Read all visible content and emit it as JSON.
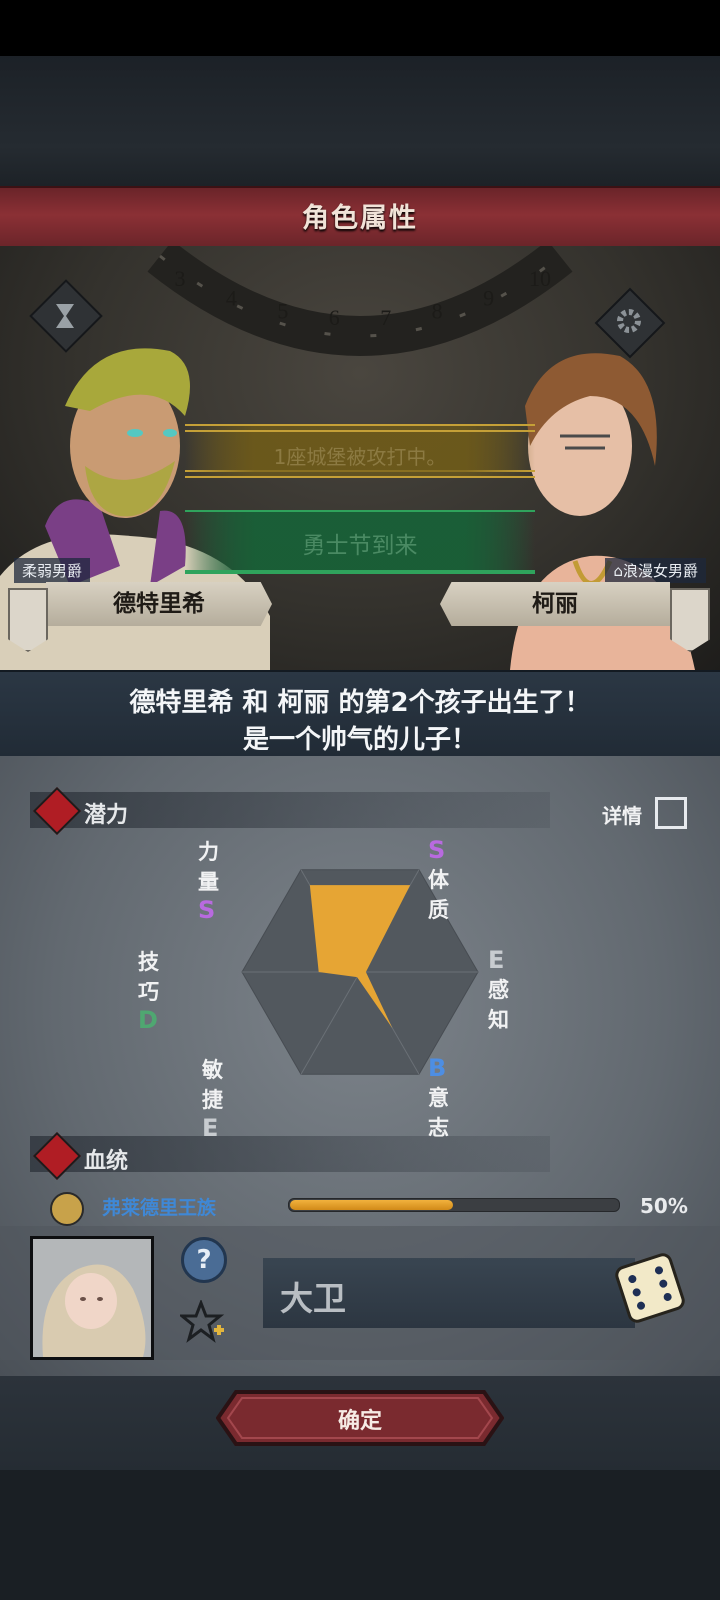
{
  "header": {
    "title": "角色属性"
  },
  "scene": {
    "dial_numbers": [
      "3",
      "4",
      "5",
      "6",
      "7",
      "8",
      "9",
      "10"
    ],
    "events": [
      "1座城堡被攻打中。",
      "勇士节到来"
    ],
    "left": {
      "trait": "柔弱男爵",
      "name": "德特里希"
    },
    "right": {
      "trait": "浪漫女男爵",
      "name": "柯丽"
    }
  },
  "message": {
    "line1": "德特里希 和 柯丽 的第2个孩子出生了！",
    "line2": "是一个帅气的儿子！"
  },
  "potential": {
    "label": "潜力",
    "details_label": "详情",
    "stats": [
      {
        "name": "力量",
        "grade": "S",
        "color": "#b86adf"
      },
      {
        "name": "体质",
        "grade": "S",
        "color": "#b86adf"
      },
      {
        "name": "感知",
        "grade": "E",
        "color": "#c8ccd0"
      },
      {
        "name": "意志",
        "grade": "B",
        "color": "#4d8ee3"
      },
      {
        "name": "敏捷",
        "grade": "E",
        "color": "#c8ccd0"
      },
      {
        "name": "技巧",
        "grade": "D",
        "color": "#4fa771"
      }
    ],
    "radar_values": [
      0.85,
      0.85,
      0.05,
      0.55,
      0.05,
      0.35
    ],
    "fill_color": "#e6a534"
  },
  "bloodline": {
    "label": "血统",
    "family": "弗莱德里王族",
    "percent_text": "50%",
    "fraction": 0.5
  },
  "child": {
    "name": "大卫"
  },
  "footer": {
    "confirm_label": "确定"
  }
}
